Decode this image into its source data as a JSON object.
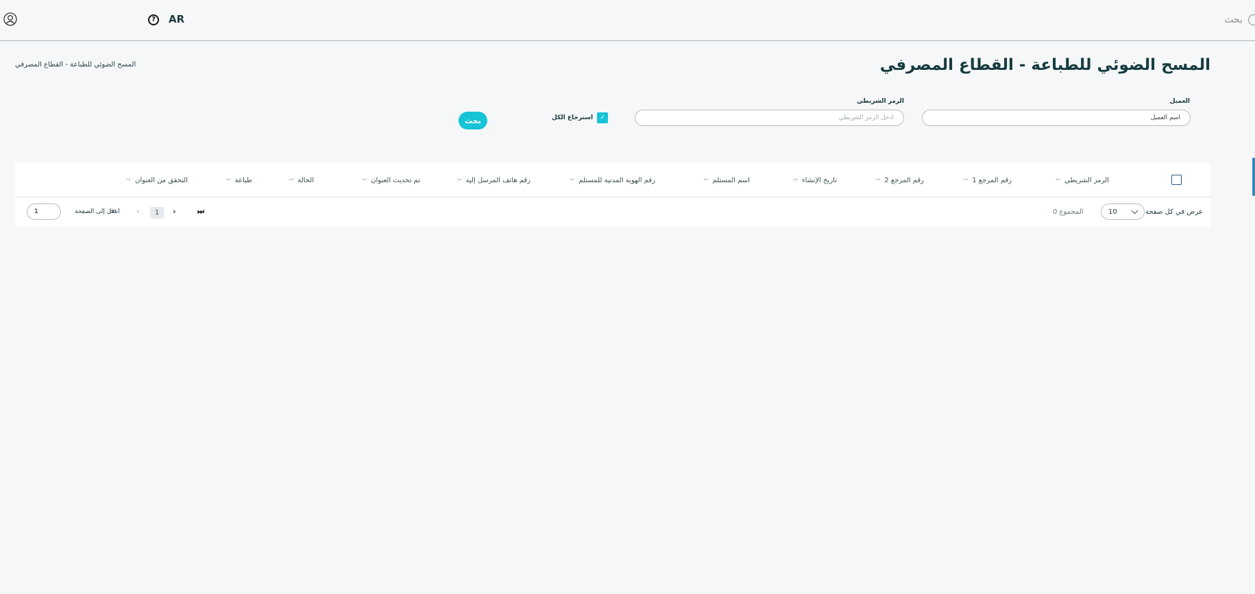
{
  "header": {
    "search_label": "بحث",
    "language": "AR",
    "help_glyph": "?"
  },
  "page": {
    "title": "المسح الضوئي للطباعة - القطاع المصرفي",
    "breadcrumb": "المسح الضوئي للطباعة - القطاع المصرفي"
  },
  "filters": {
    "client_label": "العميل",
    "client_placeholder": "اسم العميل",
    "barcode_label": "الرمز الشريطي",
    "barcode_placeholder": "أدخل الرمز الشريطي",
    "fetch_all_label": "استرجاع الكل",
    "fetch_all_checked": true,
    "search_button": "بحث"
  },
  "table": {
    "columns": [
      "الرمز الشريطي",
      "رقم المرجع 1",
      "رقم المرجع 2",
      "تاريخ الإنشاء",
      "اسم المستلم",
      "رقم الهوية المدنية للمستلم",
      "رقم هاتف المرسل إليه",
      "تم تحديث العنوان",
      "الحالة",
      "طباعة",
      "التحقق من العنوان"
    ],
    "rows": []
  },
  "pagination": {
    "per_page_label": "عرض في كل صفحة",
    "per_page_value": "10",
    "total_label": "المجموع 0",
    "current_page": "1",
    "goto_label": "انتقل إلى الصفحة",
    "goto_value": "1"
  },
  "colors": {
    "accent": "#17c3d6",
    "title": "#163b3f",
    "background": "#f5f7f9"
  }
}
